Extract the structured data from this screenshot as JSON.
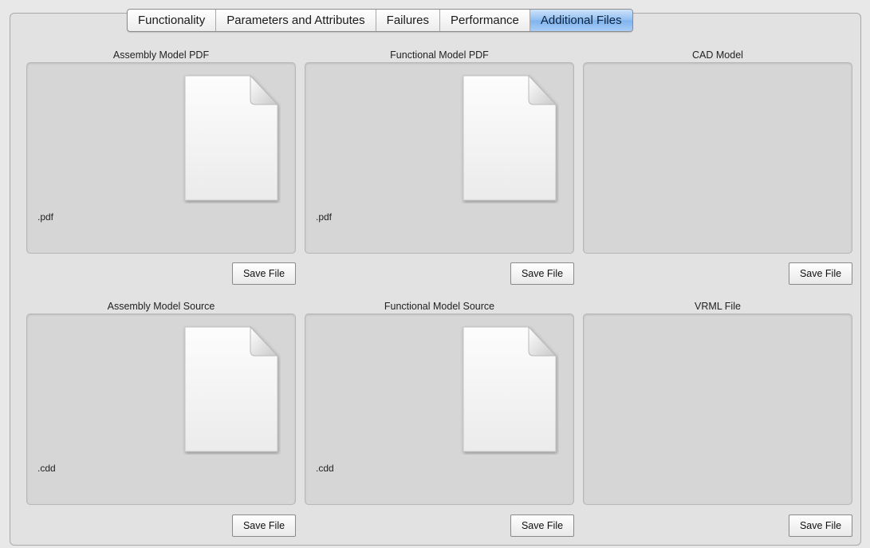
{
  "tabs": [
    {
      "label": "Functionality",
      "active": false
    },
    {
      "label": "Parameters and Attributes",
      "active": false
    },
    {
      "label": "Failures",
      "active": false
    },
    {
      "label": "Performance",
      "active": false
    },
    {
      "label": "Additional Files",
      "active": true
    }
  ],
  "panels": [
    {
      "title": "Assembly Model PDF",
      "has_file": true,
      "extension": ".pdf",
      "button_label": "Save File"
    },
    {
      "title": "Functional Model PDF",
      "has_file": true,
      "extension": ".pdf",
      "button_label": "Save File"
    },
    {
      "title": "CAD Model",
      "has_file": false,
      "extension": "",
      "button_label": "Save File"
    },
    {
      "title": "Assembly Model Source",
      "has_file": true,
      "extension": ".cdd",
      "button_label": "Save File"
    },
    {
      "title": "Functional Model Source",
      "has_file": true,
      "extension": ".cdd",
      "button_label": "Save File"
    },
    {
      "title": "VRML File",
      "has_file": false,
      "extension": "",
      "button_label": "Save File"
    }
  ],
  "icons": {
    "file": "document-icon"
  },
  "colors": {
    "active_tab": "#8fbdf1",
    "well": "#d6d6d6"
  }
}
